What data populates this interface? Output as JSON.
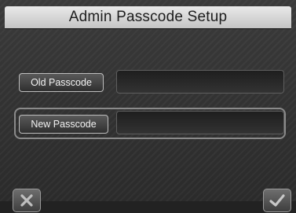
{
  "window": {
    "title": "Admin Passcode Setup"
  },
  "form": {
    "old_passcode_label": "Old Passcode",
    "old_passcode_value": "",
    "new_passcode_label": "New Passcode",
    "new_passcode_value": ""
  },
  "actions": {
    "cancel_icon": "close-icon",
    "confirm_icon": "check-icon"
  },
  "colors": {
    "background": "#2e2e2e",
    "title_bar": "#d8d8d8",
    "focus_border": "#8a8a8a"
  }
}
